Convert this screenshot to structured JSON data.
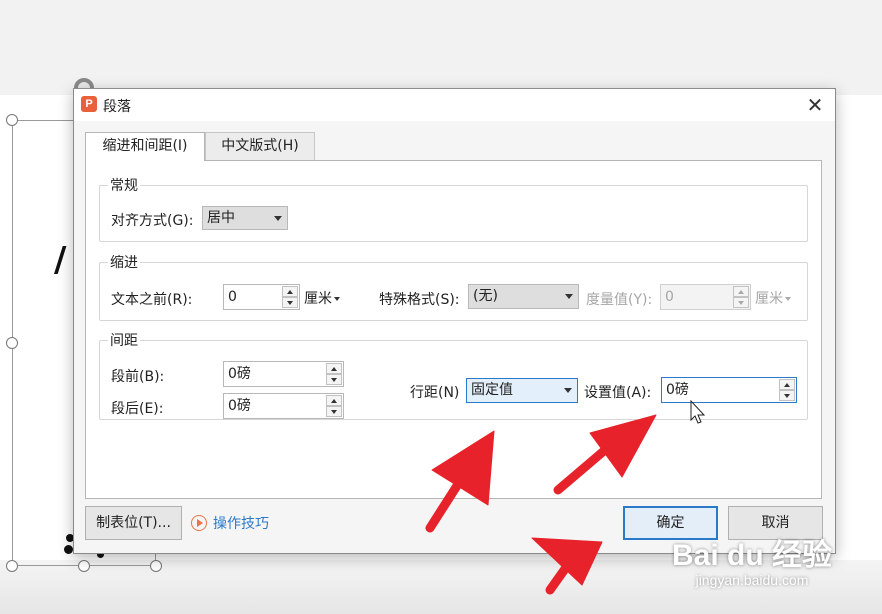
{
  "dialog": {
    "title": "段落",
    "app_icon_letter": "P",
    "close_symbol": "✕",
    "tabs": [
      {
        "label": "缩进和间距(I)",
        "active": true
      },
      {
        "label": "中文版式(H)",
        "active": false
      }
    ],
    "general": {
      "legend": "常规",
      "alignment_label": "对齐方式(G):",
      "alignment_value": "居中"
    },
    "indent": {
      "legend": "缩进",
      "before_text_label": "文本之前(R):",
      "before_text_value": "0",
      "before_text_unit": "厘米",
      "special_label": "特殊格式(S):",
      "special_value": "(无)",
      "measure_label": "度量值(Y):",
      "measure_value": "0",
      "measure_unit": "厘米"
    },
    "spacing": {
      "legend": "间距",
      "before_label": "段前(B):",
      "before_value": "0磅",
      "after_label": "段后(E):",
      "after_value": "0磅",
      "line_spacing_label": "行距(N)",
      "line_spacing_value": "固定值",
      "set_value_label": "设置值(A):",
      "set_value_value": "0磅"
    },
    "tab_stops_button": "制表位(T)...",
    "tips_link": "操作技巧",
    "ok_button": "确定",
    "cancel_button": "取消"
  },
  "watermark": {
    "logo": "Bai du 经验",
    "url": "jingyan.baidu.com"
  },
  "colors": {
    "accent": "#2b79c9",
    "annotation_arrow": "#e8222a",
    "app_icon": "#e8613a"
  }
}
